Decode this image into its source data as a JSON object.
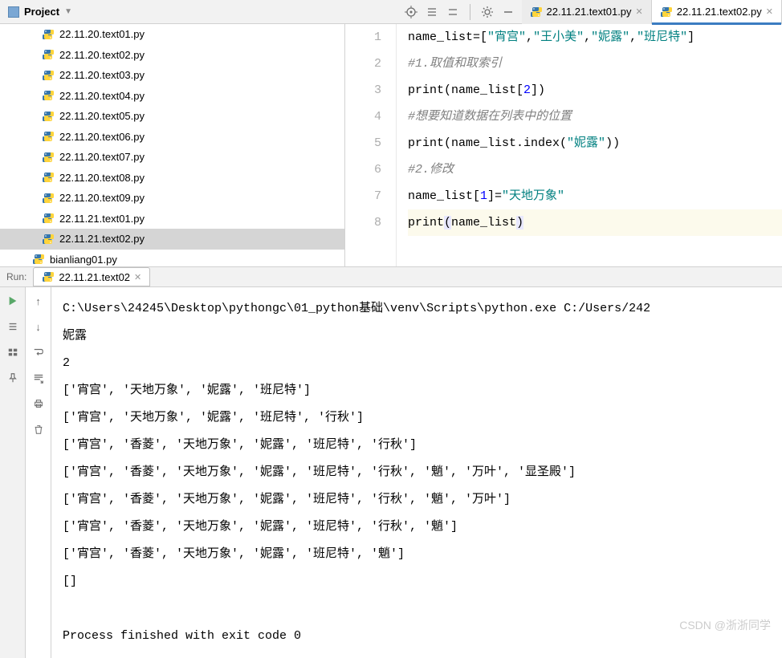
{
  "sidebar": {
    "title": "Project",
    "files": [
      {
        "name": "22.11.20.text01.py"
      },
      {
        "name": "22.11.20.text02.py"
      },
      {
        "name": "22.11.20.text03.py"
      },
      {
        "name": "22.11.20.text04.py"
      },
      {
        "name": "22.11.20.text05.py"
      },
      {
        "name": "22.11.20.text06.py"
      },
      {
        "name": "22.11.20.text07.py"
      },
      {
        "name": "22.11.20.text08.py"
      },
      {
        "name": "22.11.20.text09.py"
      },
      {
        "name": "22.11.21.text01.py"
      },
      {
        "name": "22.11.21.text02.py",
        "selected": true
      },
      {
        "name": "bianliang01.py",
        "lessIndent": true
      }
    ]
  },
  "tabs": [
    {
      "label": "22.11.21.text01.py",
      "active": false
    },
    {
      "label": "22.11.21.text02.py",
      "active": true
    }
  ],
  "code": {
    "lines": [
      {
        "n": 1,
        "html": "name_list=[<span class='str'>\"宵宫\"</span>,<span class='str'>\"王小美\"</span>,<span class='str'>\"妮露\"</span>,<span class='str'>\"班尼特\"</span>]"
      },
      {
        "n": 2,
        "html": "<span class='comment'>#1.取值和取索引</span>"
      },
      {
        "n": 3,
        "html": "print(name_list[<span class='num'>2</span>])"
      },
      {
        "n": 4,
        "html": "<span class='comment'>#想要知道数据在列表中的位置</span>"
      },
      {
        "n": 5,
        "html": "print(name_list.index(<span class='str'>\"妮露\"</span>))"
      },
      {
        "n": 6,
        "html": "<span class='comment'>#2.修改</span>"
      },
      {
        "n": 7,
        "html": "name_list[<span class='num'>1</span>]=<span class='str'>\"天地万象\"</span>"
      },
      {
        "n": 8,
        "html": "print<span class='hl-br'>(</span>name_list<span class='hl-br'>)</span>",
        "hl": true
      }
    ]
  },
  "run": {
    "label": "Run:",
    "tab": "22.11.21.text02",
    "output": [
      "C:\\Users\\24245\\Desktop\\pythongc\\01_python基础\\venv\\Scripts\\python.exe C:/Users/242",
      "妮露",
      "2",
      "['宵宫', '天地万象', '妮露', '班尼特']",
      "['宵宫', '天地万象', '妮露', '班尼特', '行秋']",
      "['宵宫', '香菱', '天地万象', '妮露', '班尼特', '行秋']",
      "['宵宫', '香菱', '天地万象', '妮露', '班尼特', '行秋', '魈', '万叶', '显圣殿']",
      "['宵宫', '香菱', '天地万象', '妮露', '班尼特', '行秋', '魈', '万叶']",
      "['宵宫', '香菱', '天地万象', '妮露', '班尼特', '行秋', '魈']",
      "['宵宫', '香菱', '天地万象', '妮露', '班尼特', '魈']",
      "[]",
      "",
      "Process finished with exit code 0"
    ]
  },
  "watermark": "CSDN @浙浙同学"
}
